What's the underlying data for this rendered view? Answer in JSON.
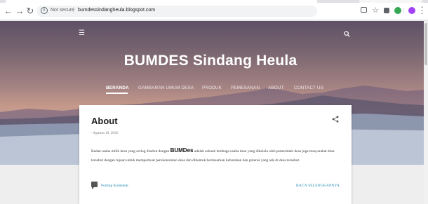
{
  "browser": {
    "security_label": "Not secure",
    "separator": "|",
    "url": "bumdessindangheula.blogspot.com",
    "nav_icons": [
      "back-icon",
      "forward-icon",
      "reload-icon"
    ],
    "extension_colors": [
      "#5f6368",
      "#34a853",
      "#9aa0a6",
      "#a142f4"
    ]
  },
  "header": {
    "title": "BUMDES Sindang Heula",
    "menu_icon": "☰",
    "nav": [
      {
        "label": "BERANDA",
        "active": true
      },
      {
        "label": "GAMBARAN UMUM DESA",
        "active": false
      },
      {
        "label": "PRODUK",
        "active": false
      },
      {
        "label": "PEMESANAN",
        "active": false
      },
      {
        "label": "ABOUT",
        "active": false
      },
      {
        "label": "CONTACT US",
        "active": false
      }
    ]
  },
  "post": {
    "title": "About",
    "date": "- Agustus 19, 2018",
    "body_before": "Badan usaha milik desa yang sering disebut dengan ",
    "body_bold": "BUMDes",
    "body_after": " adalah sebuah lembaga usaha desa yang dikelola oleh pemerintah desa juga masyarakat desa tersebut dengan tujuan untuk memperkuat perekonomian desa dan dibentuk berdasarkan kebutuhan dan potensi yang ada di desa tersebut.",
    "comment_label": "Posting Komentar",
    "read_more_label": "BACA SELENGKAPNYA"
  },
  "colors": {
    "link": "#1e88b4",
    "hero_top": "#5f5066",
    "hero_glow": "#c69a8a"
  }
}
